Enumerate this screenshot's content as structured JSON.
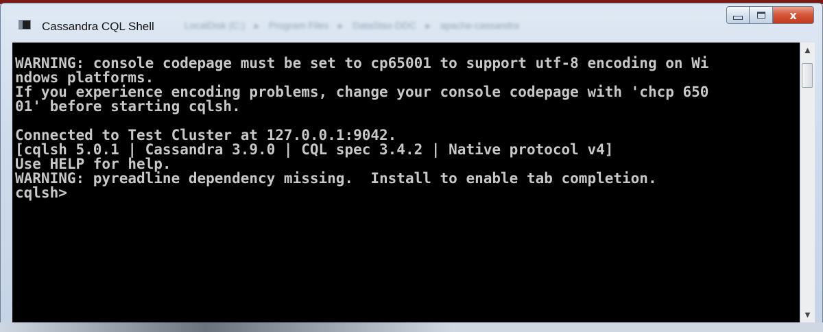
{
  "window": {
    "title": "Cassandra CQL Shell",
    "icon": "console-window-icon",
    "breadcrumb": [
      "LocalDisk (C:)",
      "Program Files",
      "DataStax-DDC",
      "apache-cassandra"
    ],
    "buttons": {
      "minimize": "minimize-icon",
      "maximize": "maximize-icon",
      "close_label": "x"
    }
  },
  "console": {
    "lines": [
      "WARNING: console codepage must be set to cp65001 to support utf-8 encoding on Wi",
      "ndows platforms.",
      "If you experience encoding problems, change your console codepage with 'chcp 650",
      "01' before starting cqlsh.",
      "",
      "Connected to Test Cluster at 127.0.0.1:9042.",
      "[cqlsh 5.0.1 | Cassandra 3.9.0 | CQL spec 3.4.2 | Native protocol v4]",
      "Use HELP for help.",
      "WARNING: pyreadline dependency missing.  Install to enable tab completion.",
      "cqlsh>"
    ]
  },
  "scrollbar": {
    "up_icon": "scroll-up-arrow-icon",
    "down_icon": "scroll-down-arrow-icon"
  }
}
